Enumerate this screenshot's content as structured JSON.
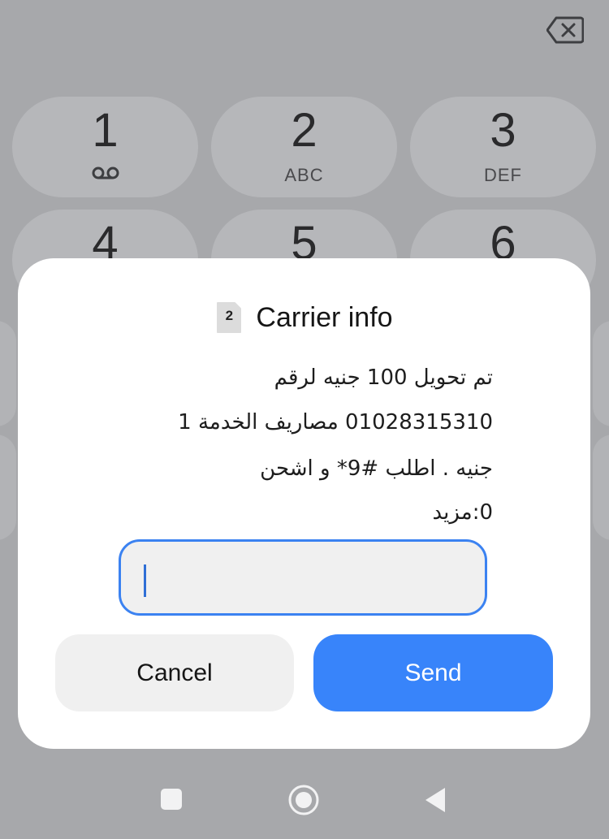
{
  "dialpad": {
    "keys": [
      {
        "digit": "1",
        "letters": ""
      },
      {
        "digit": "2",
        "letters": "ABC"
      },
      {
        "digit": "3",
        "letters": "DEF"
      },
      {
        "digit": "4",
        "letters": ""
      },
      {
        "digit": "5",
        "letters": ""
      },
      {
        "digit": "6",
        "letters": ""
      }
    ],
    "voicemail_icon": "voicemail-icon",
    "backspace_icon": "backspace-icon"
  },
  "dialog": {
    "sim_number": "2",
    "title": "Carrier info",
    "message_lines": [
      "تم تحويل 100 جنيه لرقم",
      "01028315310 مصاريف الخدمة 1",
      "جنيه . اطلب #9* و اشحن",
      "0:مزيد"
    ],
    "input_value": "",
    "cancel_label": "Cancel",
    "send_label": "Send"
  },
  "nav_bar": {
    "icons": [
      "recents-square-icon",
      "home-circle-icon",
      "back-triangle-icon"
    ]
  },
  "colors": {
    "overlay": "#a7a8ab",
    "accent": "#3884fa",
    "input_border": "#3b82f1"
  }
}
